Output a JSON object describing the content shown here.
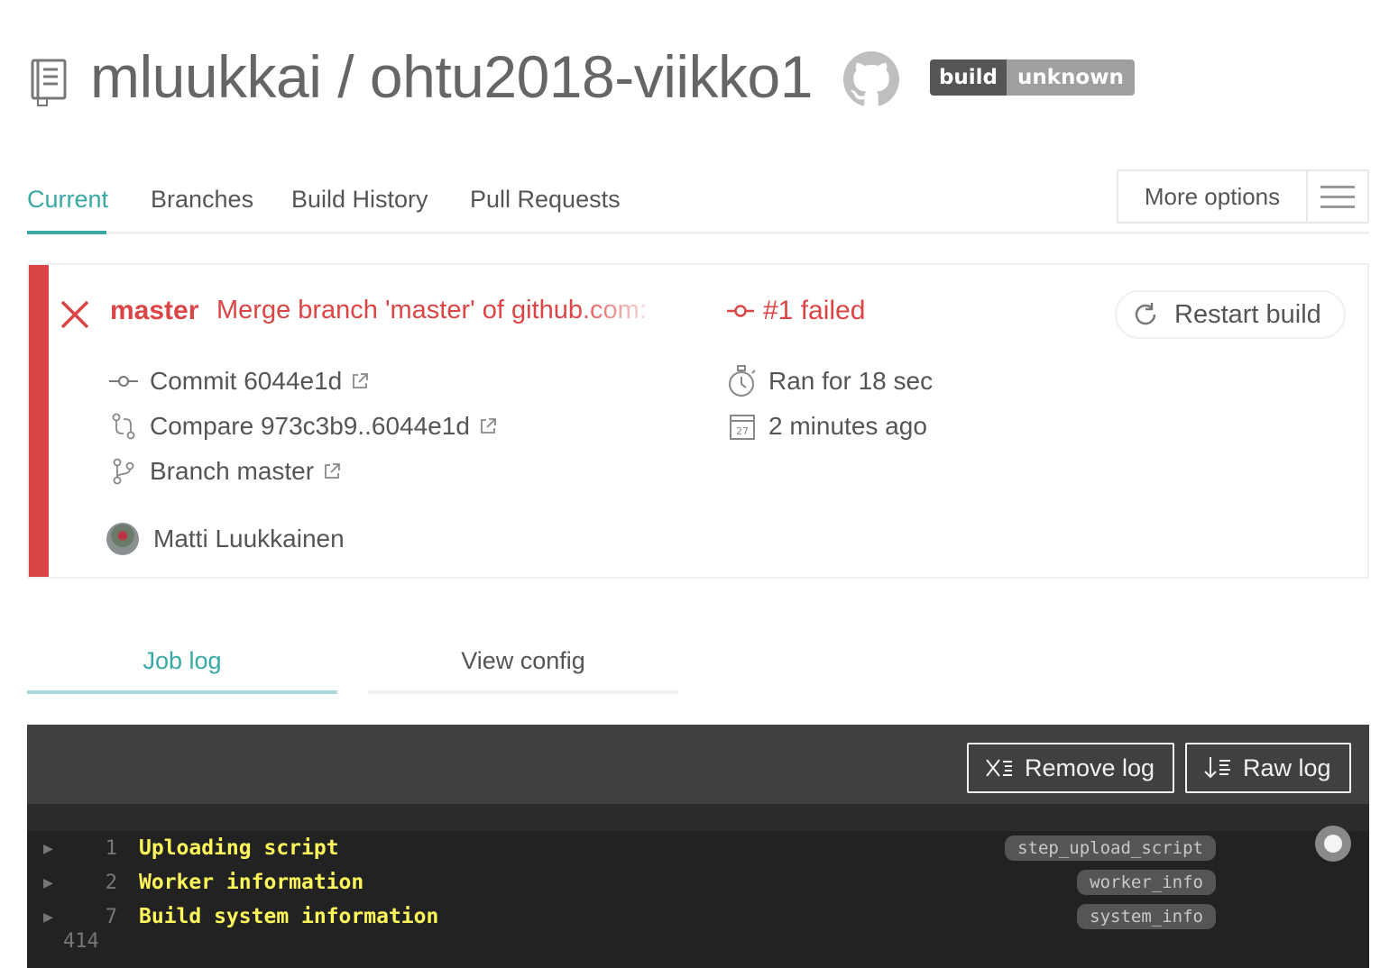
{
  "header": {
    "repo_title": "mluukkai / ohtu2018-viikko1",
    "badge_left": "build",
    "badge_right": "unknown"
  },
  "tabs": {
    "current": "Current",
    "branches": "Branches",
    "build_history": "Build History",
    "pull_requests": "Pull Requests",
    "more_options": "More options"
  },
  "build": {
    "branch": "master",
    "commit_message": "Merge branch 'master' of github.com:",
    "build_status": "#1 failed",
    "restart_label": "Restart build",
    "commit": "Commit 6044e1d",
    "compare": "Compare 973c3b9..6044e1d",
    "branch_link": "Branch master",
    "author": "Matti Luukkainen",
    "duration": "Ran for 18 sec",
    "finished": "2 minutes ago",
    "calendar_day": "27",
    "status_color": "#db4545"
  },
  "log_tabs": {
    "job_log": "Job log",
    "view_config": "View config"
  },
  "log": {
    "remove_label": "Remove log",
    "raw_label": "Raw log",
    "lines": [
      {
        "num": "1",
        "text": "Uploading script",
        "tag": "step_upload_script"
      },
      {
        "num": "2",
        "text": "Worker information",
        "tag": "worker_info"
      },
      {
        "num": "7",
        "text": "Build system information",
        "tag": "system_info"
      }
    ],
    "last_line_num": "414"
  },
  "colors": {
    "accent": "#39a9a6",
    "failed": "#db4545",
    "log_text": "#fff65c",
    "log_bg": "#222222"
  }
}
